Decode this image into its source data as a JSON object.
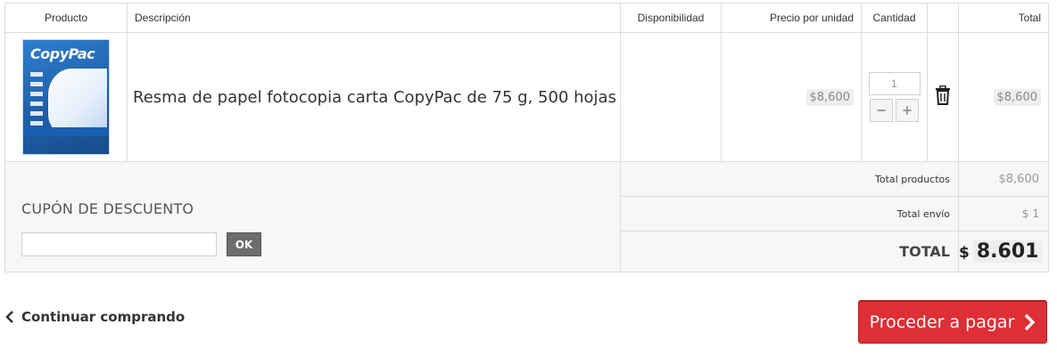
{
  "table_headers": {
    "producto": "Producto",
    "descripcion": "Descripción",
    "disponibilidad": "Disponibilidad",
    "precio_unidad": "Precio por unidad",
    "cantidad": "Cantidad",
    "total": "Total"
  },
  "item": {
    "thumbnail_brand": "CopyPac",
    "description": "Resma de papel fotocopia carta CopyPac de 75 g, 500 hojas",
    "availability": "",
    "unit_price": "$8,600",
    "quantity": "1",
    "minus_label": "−",
    "plus_label": "+",
    "line_total": "$8,600",
    "delete_icon": "trash-icon"
  },
  "coupon": {
    "title": "CUPÓN DE DESCUENTO",
    "input_value": "",
    "input_placeholder": "",
    "ok_label": "OK"
  },
  "summary": {
    "total_products_label": "Total productos",
    "total_products_value": "$8,600",
    "shipping_label": "Total envío",
    "shipping_value": "$ 1",
    "grand_label": "TOTAL",
    "grand_currency": "$",
    "grand_value": "8.601"
  },
  "actions": {
    "continue_label": "Continuar comprando",
    "proceed_label": "Proceder a pagar"
  },
  "colors": {
    "accent_red": "#dd2f35",
    "ok_button": "#6d6d6d"
  }
}
